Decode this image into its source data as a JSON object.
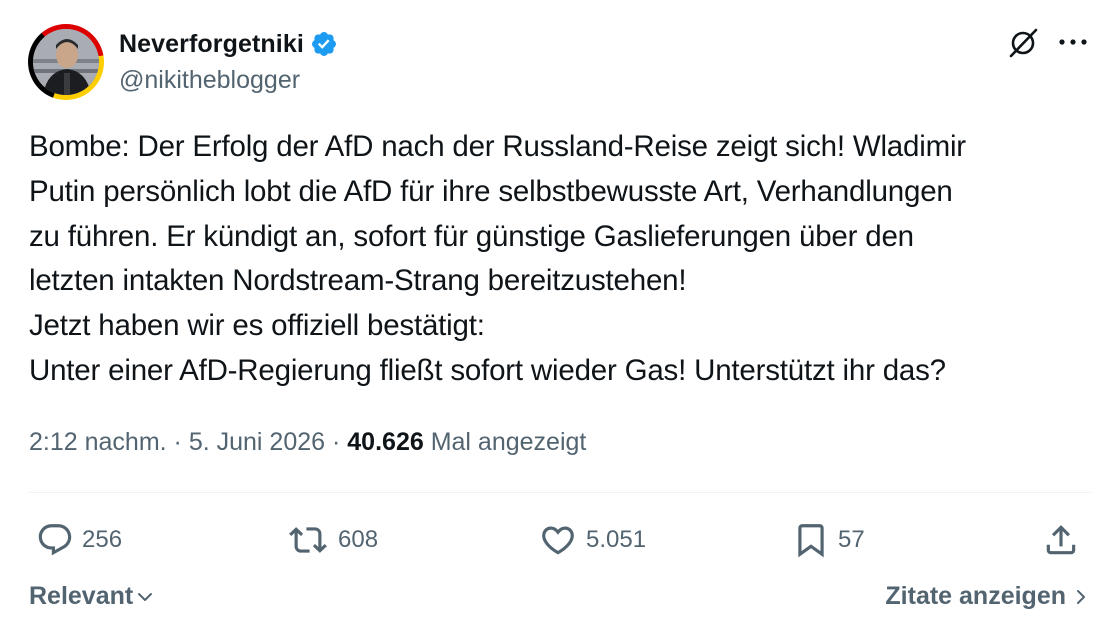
{
  "author": {
    "display_name": "Neverforgetniki",
    "handle": "@nikitheblogger",
    "verified": true,
    "verified_color": "#1d9bf0"
  },
  "header_icons": [
    "grok-icon",
    "more-options-icon"
  ],
  "tweet": {
    "lines": [
      "Bombe: Der Erfolg der AfD nach der Russland-Reise zeigt sich! Wladimir",
      "Putin persönlich lobt die AfD für ihre selbstbewusste Art, Verhandlungen",
      "zu führen. Er kündigt an, sofort für günstige Gaslieferungen über den",
      "letzten intakten Nordstream-Strang bereitzustehen!",
      "Jetzt haben wir es offiziell bestätigt:",
      "Unter einer AfD-Regierung fließt sofort wieder Gas! Unterstützt ihr das?"
    ]
  },
  "meta": {
    "time": "2:12 nachm.",
    "separator": "·",
    "date": "5. Juni 2026",
    "views_count": "40.626",
    "views_label": "Mal angezeigt"
  },
  "actions": {
    "replies": "256",
    "reposts": "608",
    "likes": "5.051",
    "bookmarks": "57"
  },
  "footer": {
    "sort_label": "Relevant",
    "quotes_label": "Zitate anzeigen"
  },
  "colors": {
    "text_primary": "#0f1419",
    "text_secondary": "#536471",
    "divider": "#eff3f4"
  }
}
